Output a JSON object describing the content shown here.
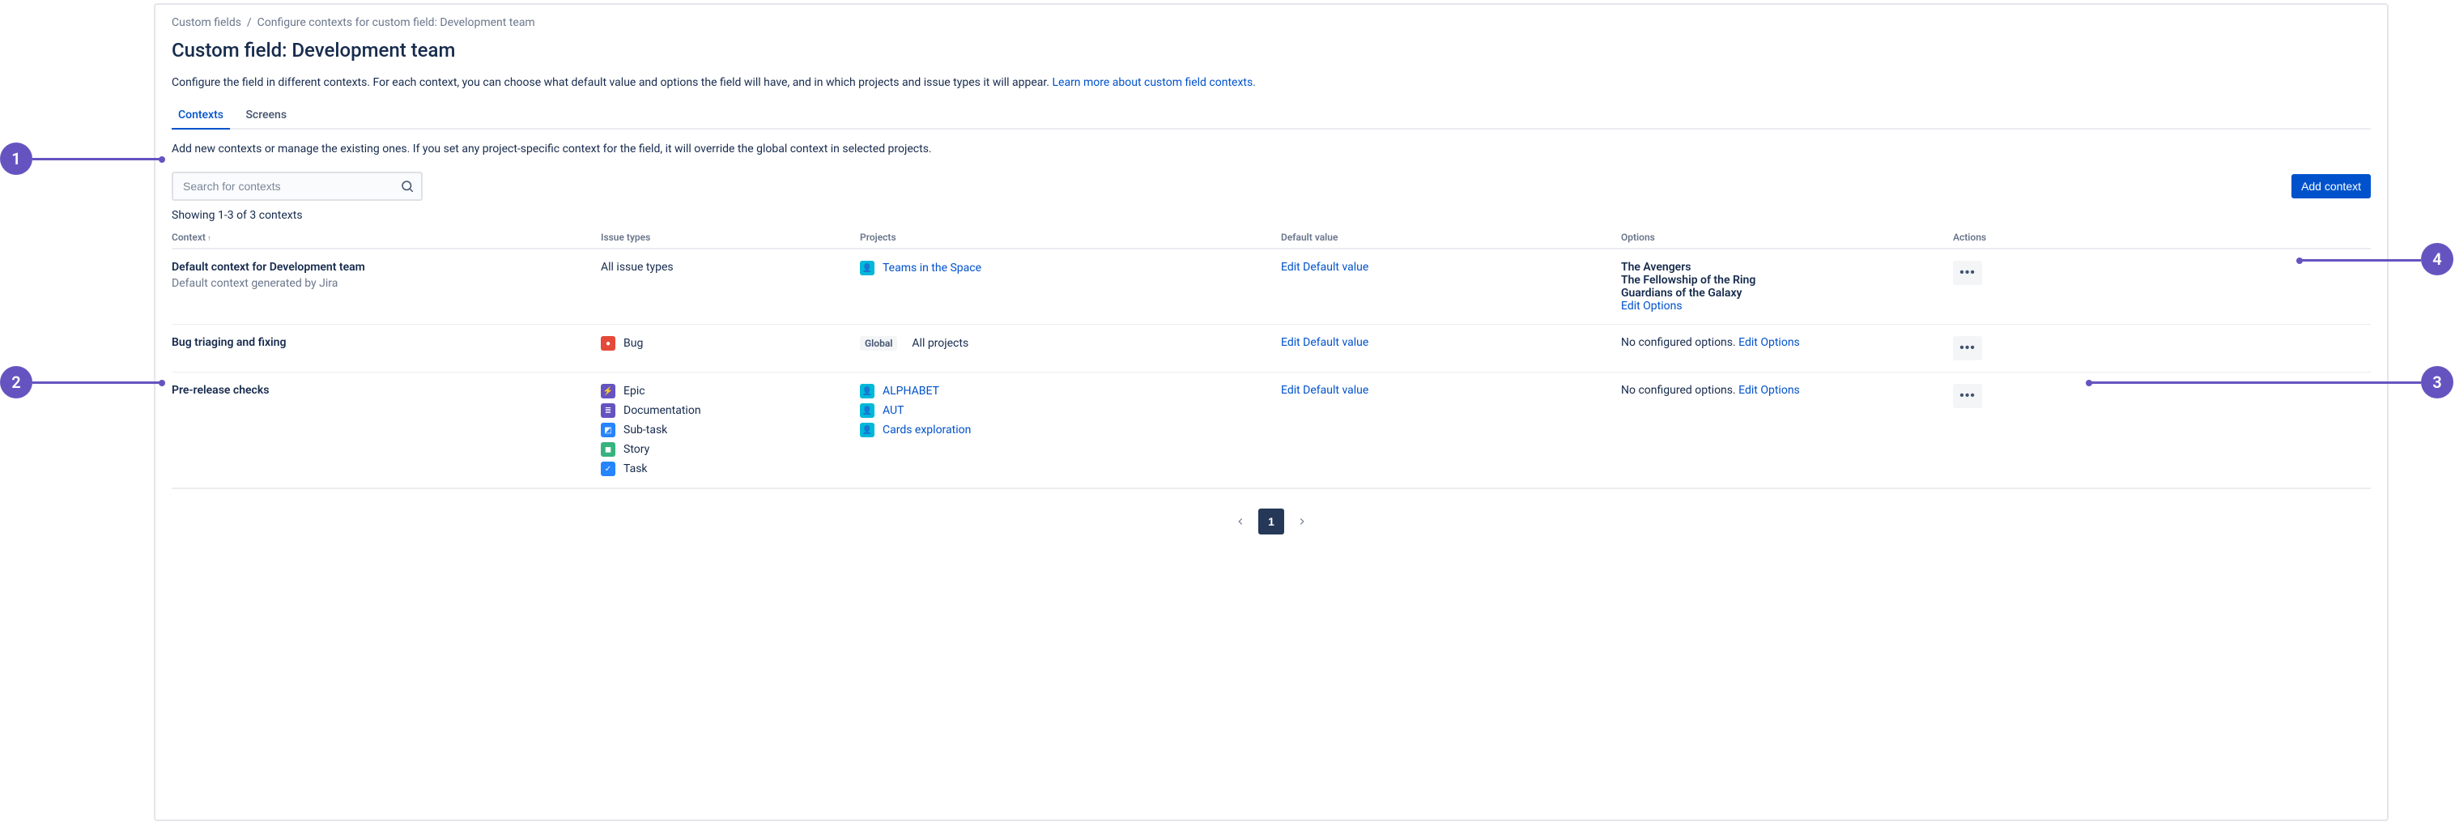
{
  "annotations": {
    "a1": "1",
    "a2": "2",
    "a3": "3",
    "a4": "4"
  },
  "breadcrumb": {
    "root": "Custom fields",
    "current": "Configure contexts for custom field: Development team"
  },
  "title": "Custom field: Development team",
  "description_text": "Configure the field in different contexts. For each context, you can choose what default value and options the field will have, and in which projects and issue types it will appear. ",
  "description_link": "Learn more about custom field contexts.",
  "tabs": {
    "contexts": "Contexts",
    "screens": "Screens"
  },
  "sub_description": "Add new contexts or manage the existing ones. If you set any project-specific context for the field, it will override the global context in selected projects.",
  "search_placeholder": "Search for contexts",
  "add_button": "Add context",
  "showing": "Showing 1-3 of 3 contexts",
  "columns": {
    "context": "Context",
    "issue_types": "Issue types",
    "projects": "Projects",
    "default_value": "Default value",
    "options": "Options",
    "actions": "Actions"
  },
  "rows": [
    {
      "name": "Default context for Development team",
      "sub": "Default context generated by Jira",
      "issue_types": [
        {
          "label": "All issue types",
          "icon": null
        }
      ],
      "projects": [
        {
          "label": "Teams in the Space",
          "icon_color": "#00B8D9",
          "link": true
        }
      ],
      "global": false,
      "default_value": "Edit Default value",
      "options": [
        "The Avengers",
        "The Fellowship of the Ring",
        "Guardians of the Galaxy"
      ],
      "options_link": "Edit Options",
      "no_options_text": null
    },
    {
      "name": "Bug triaging and fixing",
      "sub": null,
      "issue_types": [
        {
          "label": "Bug",
          "icon": "bug",
          "icon_color": "#E5493A"
        }
      ],
      "projects": [
        {
          "label": "All projects",
          "icon_color": null,
          "link": false
        }
      ],
      "global": true,
      "global_label": "Global",
      "default_value": "Edit Default value",
      "options": [],
      "options_link": "Edit Options",
      "no_options_text": "No configured options. "
    },
    {
      "name": "Pre-release checks",
      "sub": null,
      "issue_types": [
        {
          "label": "Epic",
          "icon": "epic",
          "icon_color": "#6554C0"
        },
        {
          "label": "Documentation",
          "icon": "doc",
          "icon_color": "#6554C0"
        },
        {
          "label": "Sub-task",
          "icon": "subtask",
          "icon_color": "#2684FF"
        },
        {
          "label": "Story",
          "icon": "story",
          "icon_color": "#36B37E"
        },
        {
          "label": "Task",
          "icon": "task",
          "icon_color": "#2684FF"
        }
      ],
      "projects": [
        {
          "label": "ALPHABET",
          "icon_color": "#00B8D9",
          "link": true
        },
        {
          "label": "AUT",
          "icon_color": "#00B8D9",
          "link": true
        },
        {
          "label": "Cards exploration",
          "icon_color": "#00B8D9",
          "link": true
        }
      ],
      "global": false,
      "default_value": "Edit Default value",
      "options": [],
      "options_link": "Edit Options",
      "no_options_text": "No configured options. "
    }
  ],
  "pagination": {
    "current": "1"
  }
}
